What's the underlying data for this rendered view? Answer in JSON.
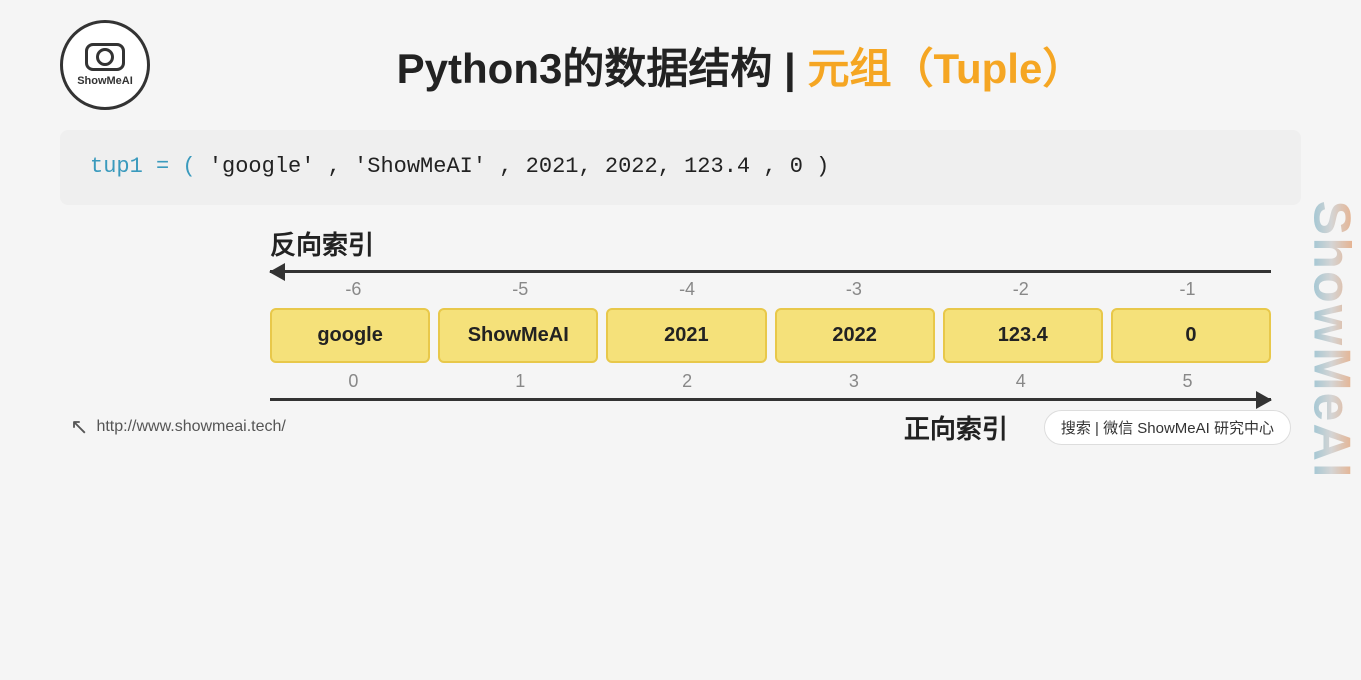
{
  "header": {
    "logo_line1": "ShowMeAI",
    "title_main": "Python3的数据结构 | ",
    "title_highlight": "元组（Tuple）"
  },
  "code": {
    "line": "tup1  =  (   'google' ,  'ShowMeAI' ,   2021,   2022,  123.4  ,  0  )"
  },
  "diagram": {
    "reverse_label": "反向索引",
    "forward_label": "正向索引",
    "reverse_indices": [
      "-6",
      "-5",
      "-4",
      "-3",
      "-2",
      "-1"
    ],
    "forward_indices": [
      "0",
      "1",
      "2",
      "3",
      "4",
      "5"
    ],
    "items": [
      "google",
      "ShowMeAI",
      "2021",
      "2022",
      "123.4",
      "0"
    ]
  },
  "watermark": {
    "text": "ShowMeAI"
  },
  "footer": {
    "url": "http://www.showmeai.tech/",
    "search_text": "搜索 | 微信 ShowMeAI 研究中心"
  }
}
